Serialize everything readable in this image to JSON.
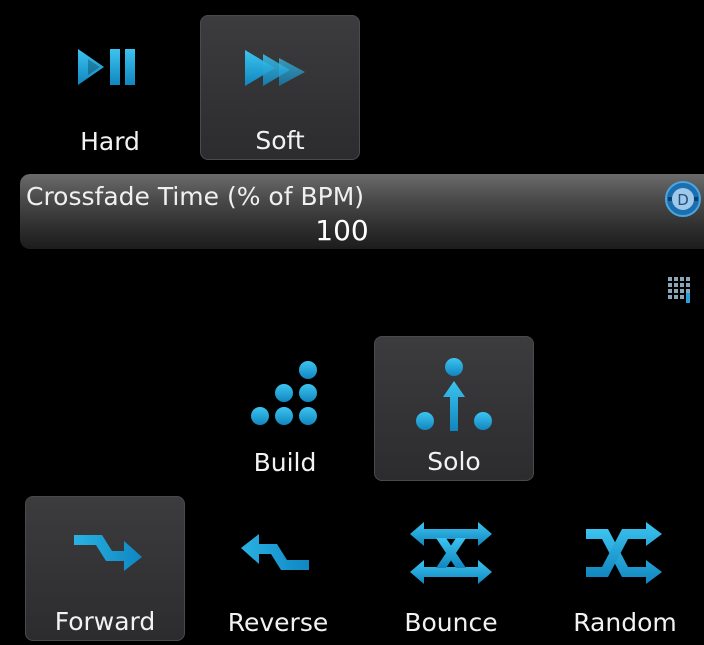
{
  "transition": {
    "hard_label": "Hard",
    "soft_label": "Soft",
    "selected": "Soft"
  },
  "crossfade": {
    "title": "Crossfade Time (% of BPM)",
    "value": "100"
  },
  "mode": {
    "build_label": "Build",
    "solo_label": "Solo",
    "selected": "Solo"
  },
  "direction": {
    "forward_label": "Forward",
    "reverse_label": "Reverse",
    "bounce_label": "Bounce",
    "random_label": "Random",
    "selected": "Forward"
  },
  "colors": {
    "accent": "#1fa8d8",
    "selected_bg": "#363638",
    "background": "#000000"
  },
  "icons": [
    "play-pause-icon",
    "fast-forward-icon",
    "settings-knob-icon",
    "keypad-icon",
    "build-dots-icon",
    "solo-arrow-icon",
    "forward-arrow-icon",
    "reverse-arrow-icon",
    "bounce-arrows-icon",
    "random-arrows-icon"
  ]
}
